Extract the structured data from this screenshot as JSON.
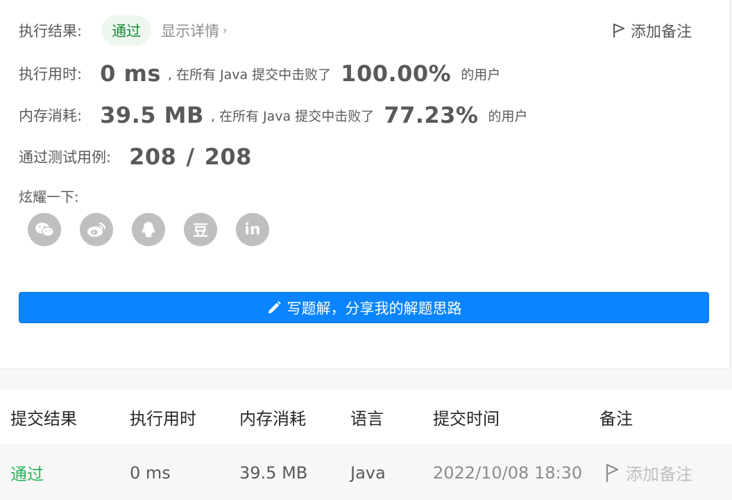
{
  "result": {
    "label": "执行结果:",
    "status": "通过",
    "details_link": "显示详情",
    "add_note": "添加备注"
  },
  "runtime": {
    "label": "执行用时:",
    "value": "0 ms",
    "beat_text": ", 在所有 Java 提交中击败了",
    "percent": "100.00%",
    "suffix": "的用户"
  },
  "memory": {
    "label": "内存消耗:",
    "value": "39.5 MB",
    "beat_text": ", 在所有 Java 提交中击败了",
    "percent": "77.23%",
    "suffix": "的用户"
  },
  "testcases": {
    "label": "通过测试用例:",
    "passed": "208",
    "separator": "/",
    "total": "208"
  },
  "share": {
    "label": "炫耀一下:",
    "icons": [
      "wechat-icon",
      "weibo-icon",
      "qq-icon",
      "douban-icon",
      "linkedin-icon"
    ],
    "douban_glyph": "豆",
    "linkedin_glyph": "in"
  },
  "write_solution_button": "写题解，分享我的解题思路",
  "submissions": {
    "headers": [
      "提交结果",
      "执行用时",
      "内存消耗",
      "语言",
      "提交时间",
      "备注"
    ],
    "rows": [
      {
        "status": "通过",
        "runtime": "0 ms",
        "memory": "39.5 MB",
        "language": "Java",
        "time": "2022/10/08 18:30",
        "note": "添加备注"
      }
    ]
  },
  "colors": {
    "accent": "#0a84ff",
    "success": "#2db55d",
    "icon_grey": "#bfbfbf"
  }
}
